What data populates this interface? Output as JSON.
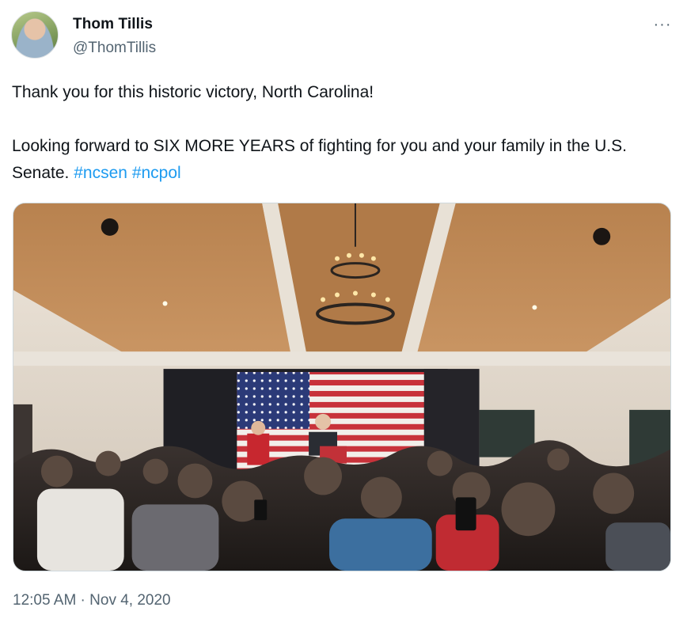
{
  "author": {
    "display_name": "Thom Tillis",
    "handle": "@ThomTillis",
    "avatar_icon": "profile-photo"
  },
  "more_icon": "more-horizontal-icon",
  "more_glyph": "···",
  "tweet": {
    "line1": "Thank you for this historic victory, North Carolina!",
    "line2": "Looking forward to SIX MORE YEARS of fighting for you and your family in the U.S. Senate.",
    "hashtags": [
      "#ncsen",
      "#ncpol"
    ]
  },
  "media": {
    "podium_sign": "THOM TILLIS"
  },
  "timestamp": "12:05 AM · Nov 4, 2020",
  "colors": {
    "text": "#0f1419",
    "secondary": "#536471",
    "link": "#1d9bf0",
    "border": "#cfd9de"
  }
}
